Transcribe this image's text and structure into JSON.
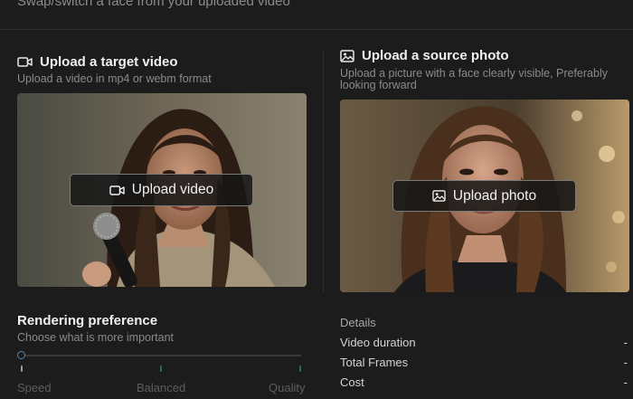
{
  "header": {
    "subtitle": "Swap/switch a face from your uploaded video"
  },
  "video_section": {
    "title": "Upload a target video",
    "subtitle": "Upload a video in mp4 or webm format",
    "icon": "video-camera-icon",
    "button_label": "Upload video"
  },
  "photo_section": {
    "title": "Upload a source photo",
    "subtitle_line1": "Upload a picture with a face clearly visible, Preferably",
    "subtitle_line2": "looking forward",
    "icon": "image-icon",
    "button_label": "Upload photo"
  },
  "preference": {
    "title": "Rendering preference",
    "subtitle": "Choose what is more important",
    "value": 0,
    "options": [
      "Speed",
      "Balanced",
      "Quality"
    ]
  },
  "details": {
    "heading": "Details",
    "rows": [
      {
        "label": "Video duration",
        "value": "-"
      },
      {
        "label": "Total Frames",
        "value": "-"
      },
      {
        "label": "Cost",
        "value": "-"
      }
    ]
  },
  "colors": {
    "background": "#1c1c1c",
    "slider_accent": "#4a86b5",
    "tick": "#2f6a5c"
  }
}
